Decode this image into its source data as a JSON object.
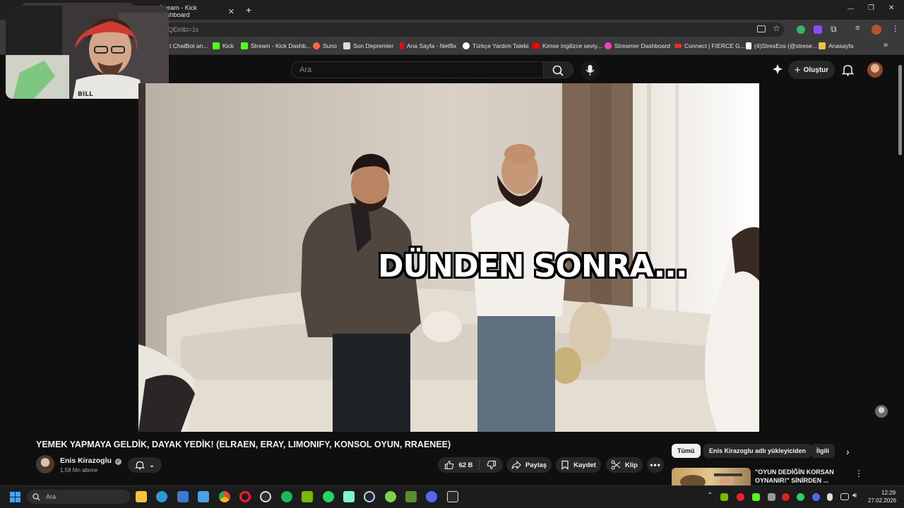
{
  "browser": {
    "tabs": [
      {
        "title": "",
        "active": true
      },
      {
        "title": "Stream - Kick Dashboard",
        "active": false
      }
    ],
    "new_tab_label": "+",
    "window_controls": [
      "—",
      "❐",
      "✕"
    ],
    "address_fragment": "QEirl&t=1s",
    "bookmarks": [
      {
        "label": "t ChatBot an...",
        "color": "#3ea6ff"
      },
      {
        "label": "Kick",
        "color": "#53fc18"
      },
      {
        "label": "Stream - Kick Dashb...",
        "color": "#53fc18"
      },
      {
        "label": "Suno",
        "color": "#ff6a3d"
      },
      {
        "label": "Son Depremler",
        "color": "#dddddd"
      },
      {
        "label": "Ana Sayfa - Netflix",
        "color": "#e50914"
      },
      {
        "label": "Türkçe Yardım Talebi",
        "color": "#ffffff"
      },
      {
        "label": "Kimse ingilizce seviy...",
        "color": "#ff0000"
      },
      {
        "label": "Streamer Dashboard",
        "color": "#ff3dbb"
      },
      {
        "label": "Connect | FIERCE G...",
        "color": "#e0322b"
      },
      {
        "label": "(4)StresEos (@strese...",
        "color": "#ffffff"
      },
      {
        "label": "Anasayfa",
        "color": "#f0c040"
      }
    ],
    "overflow_label": "»"
  },
  "youtube": {
    "search_placeholder": "Ara",
    "create_label": "Oluştur",
    "video_caption": "DÜNDEN SONRA...",
    "video_title": "YEMEK YAPMAYA GELDİK, DAYAK YEDİK! (ELRAEN, ERAY, LIMONIFY, KONSOL OYUN, RRAENEE)",
    "channel": {
      "name": "Enis Kirazoglu",
      "subscribers": "1,58 Mn abone"
    },
    "actions": {
      "likes": "62 B",
      "share": "Paylaş",
      "save": "Kaydet",
      "clip": "Klip"
    },
    "chips": [
      "Tümü",
      "Enis Kirazoglu adlı yükleyiciden",
      "İlgili"
    ],
    "recommendation": {
      "title_line1": "\"OYUN DEDİĞİN KORSAN",
      "title_line2": "OYNANIR!\" SİNİRDEN ..."
    }
  },
  "taskbar": {
    "search_placeholder": "Ara",
    "time": "12:29",
    "date": "27.02.2026"
  },
  "colors": {
    "accent_red": "#ff0000",
    "kick_green": "#53fc18"
  }
}
